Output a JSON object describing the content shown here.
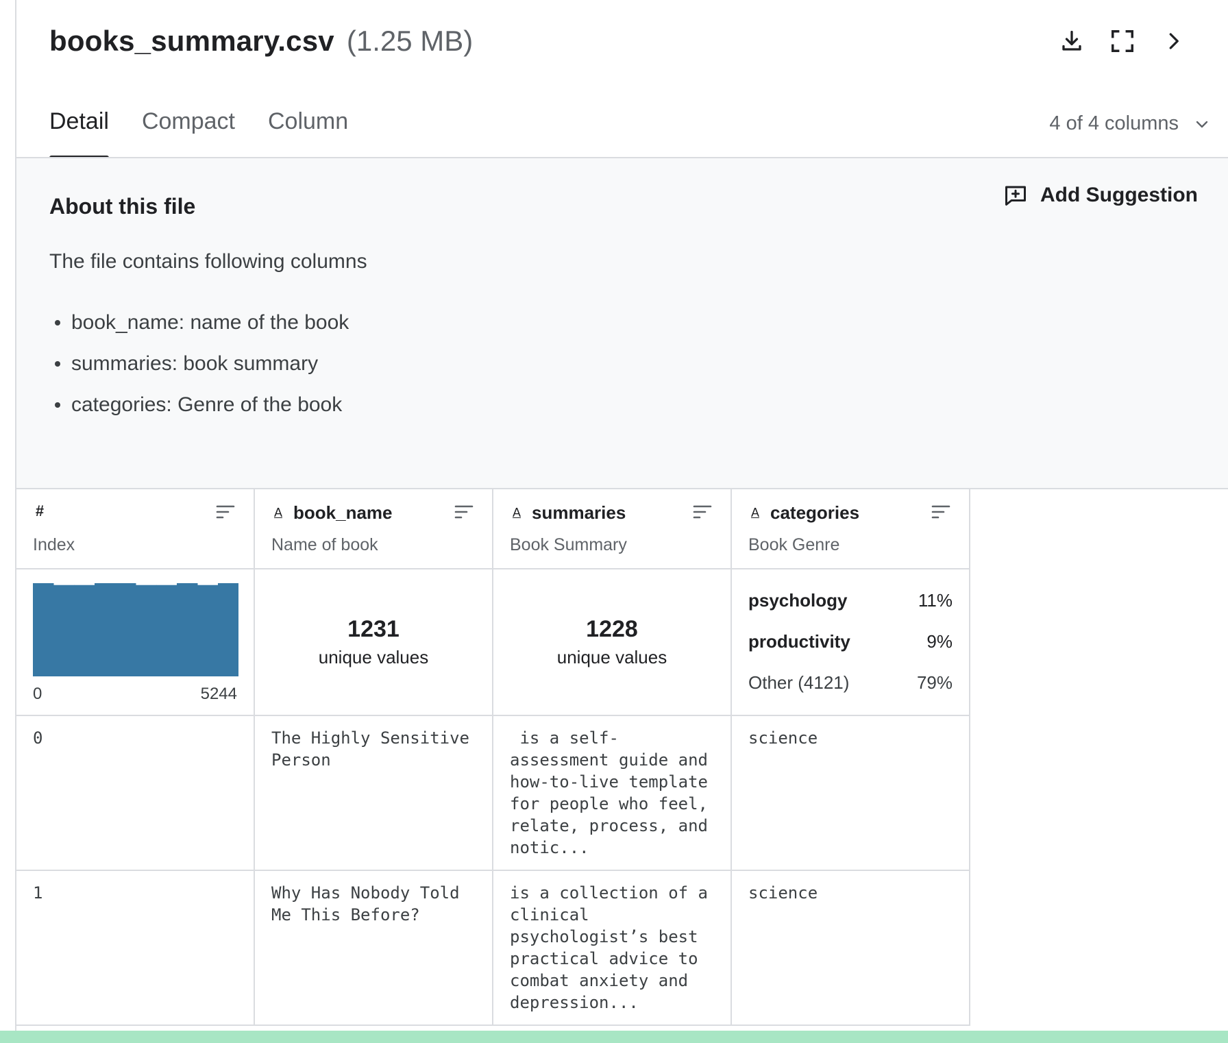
{
  "file": {
    "name": "books_summary.csv",
    "size": "(1.25 MB)"
  },
  "header": {
    "icons": [
      "download-icon",
      "fullscreen-icon",
      "chevron-right-icon"
    ],
    "tabs": [
      "Detail",
      "Compact",
      "Column"
    ],
    "active_tab": "Detail",
    "columns_selector": "4 of 4 columns"
  },
  "about": {
    "title": "About this file",
    "add_suggestion": "Add Suggestion",
    "description": "The file contains following columns",
    "items": [
      "book_name: name of the book",
      "summaries: book summary",
      "categories: Genre of the book"
    ]
  },
  "columns": [
    {
      "type_symbol": "#",
      "name": "",
      "subtitle": "Index"
    },
    {
      "type_symbol": "A",
      "name": "book_name",
      "subtitle": "Name of book"
    },
    {
      "type_symbol": "A",
      "name": "summaries",
      "subtitle": "Book Summary"
    },
    {
      "type_symbol": "A",
      "name": "categories",
      "subtitle": "Book Genre"
    }
  ],
  "stats": {
    "index_hist": {
      "min": "0",
      "max": "5244",
      "color": "#3778a4",
      "bins": [
        1.0,
        0.98,
        0.98,
        1.0,
        1.0,
        0.98,
        0.98,
        1.0,
        0.98,
        1.0
      ]
    },
    "book_name": {
      "unique_count": "1231",
      "unique_label": "unique values"
    },
    "summaries": {
      "unique_count": "1228",
      "unique_label": "unique values"
    },
    "categories": [
      {
        "name": "psychology",
        "pct": "11%"
      },
      {
        "name": "productivity",
        "pct": "9%"
      },
      {
        "name": "Other (4121)",
        "pct": "79%"
      }
    ]
  },
  "rows": [
    {
      "index": "0",
      "book_name": "The Highly Sensitive Person",
      "summaries": " is a self-assessment guide and how-to-live template for people who feel, relate, process, and notic...",
      "categories": "science"
    },
    {
      "index": "1",
      "book_name": "Why Has Nobody Told Me This Before?",
      "summaries": "is a collection of a clinical psychologist’s best practical advice to combat anxiety and depression...",
      "categories": "science"
    }
  ]
}
